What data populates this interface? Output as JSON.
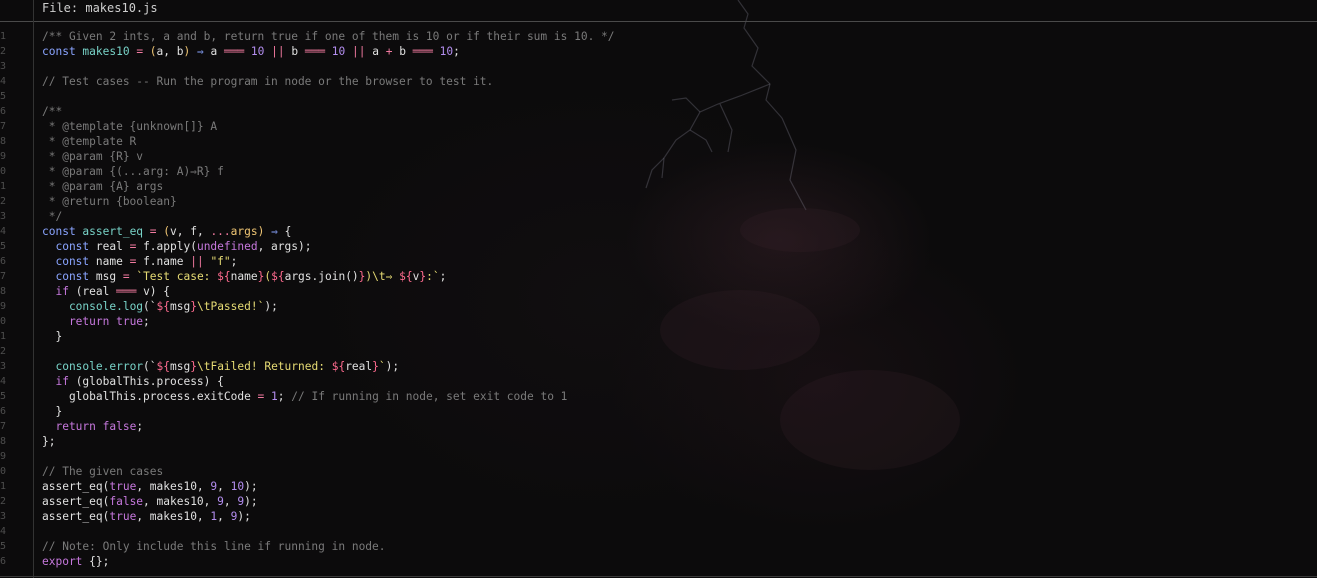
{
  "header": {
    "file_label": "File: makes10.js"
  },
  "lines": [
    {
      "n": "1",
      "tokens": [
        {
          "t": "/** Given 2 ints, a and b, return true if one of them is 10 or if their sum is 10. */",
          "c": "c"
        }
      ]
    },
    {
      "n": "2",
      "tokens": [
        {
          "t": "const ",
          "c": "kw"
        },
        {
          "t": "makes10",
          "c": "fn"
        },
        {
          "t": " = ",
          "c": "op"
        },
        {
          "t": "(",
          "c": "par"
        },
        {
          "t": "a, b",
          "c": "pl"
        },
        {
          "t": ")",
          "c": "par"
        },
        {
          "t": " ⇒ ",
          "c": "kw"
        },
        {
          "t": "a ",
          "c": "pl"
        },
        {
          "t": "═══ ",
          "c": "op"
        },
        {
          "t": "10",
          "c": "num"
        },
        {
          "t": " || ",
          "c": "op"
        },
        {
          "t": "b ",
          "c": "pl"
        },
        {
          "t": "═══ ",
          "c": "op"
        },
        {
          "t": "10",
          "c": "num"
        },
        {
          "t": " || ",
          "c": "op"
        },
        {
          "t": "a ",
          "c": "pl"
        },
        {
          "t": "+ ",
          "c": "op"
        },
        {
          "t": "b ",
          "c": "pl"
        },
        {
          "t": "═══ ",
          "c": "op"
        },
        {
          "t": "10",
          "c": "num"
        },
        {
          "t": ";",
          "c": "pl"
        }
      ]
    },
    {
      "n": "3",
      "tokens": []
    },
    {
      "n": "4",
      "tokens": [
        {
          "t": "// Test cases -- Run the program in node or the browser to test it.",
          "c": "c"
        }
      ]
    },
    {
      "n": "5",
      "tokens": []
    },
    {
      "n": "6",
      "tokens": [
        {
          "t": "/**",
          "c": "c"
        }
      ]
    },
    {
      "n": "7",
      "tokens": [
        {
          "t": " * @template {unknown[]} A",
          "c": "c"
        }
      ]
    },
    {
      "n": "8",
      "tokens": [
        {
          "t": " * @template R",
          "c": "c"
        }
      ]
    },
    {
      "n": "9",
      "tokens": [
        {
          "t": " * @param {R} v",
          "c": "c"
        }
      ]
    },
    {
      "n": "0",
      "tokens": [
        {
          "t": " * @param {(...arg: A)⇒R} f",
          "c": "c"
        }
      ]
    },
    {
      "n": "1",
      "tokens": [
        {
          "t": " * @param {A} args",
          "c": "c"
        }
      ]
    },
    {
      "n": "2",
      "tokens": [
        {
          "t": " * @return {boolean}",
          "c": "c"
        }
      ]
    },
    {
      "n": "3",
      "tokens": [
        {
          "t": " */",
          "c": "c"
        }
      ]
    },
    {
      "n": "4",
      "tokens": [
        {
          "t": "const ",
          "c": "kw"
        },
        {
          "t": "assert_eq",
          "c": "fn"
        },
        {
          "t": " = ",
          "c": "op"
        },
        {
          "t": "(",
          "c": "par"
        },
        {
          "t": "v, f, ",
          "c": "pl"
        },
        {
          "t": "...",
          "c": "op"
        },
        {
          "t": "args",
          "c": "par"
        },
        {
          "t": ")",
          "c": "par"
        },
        {
          "t": " ⇒ ",
          "c": "kw"
        },
        {
          "t": "{",
          "c": "pl"
        }
      ]
    },
    {
      "n": "5",
      "tokens": [
        {
          "t": "  const ",
          "c": "kw"
        },
        {
          "t": "real ",
          "c": "pl"
        },
        {
          "t": "= ",
          "c": "op"
        },
        {
          "t": "f.apply(",
          "c": "pl"
        },
        {
          "t": "undefined",
          "c": "kw2"
        },
        {
          "t": ", args);",
          "c": "pl"
        }
      ]
    },
    {
      "n": "6",
      "tokens": [
        {
          "t": "  const ",
          "c": "kw"
        },
        {
          "t": "name ",
          "c": "pl"
        },
        {
          "t": "= ",
          "c": "op"
        },
        {
          "t": "f.name ",
          "c": "pl"
        },
        {
          "t": "|| ",
          "c": "op"
        },
        {
          "t": "\"f\"",
          "c": "str"
        },
        {
          "t": ";",
          "c": "pl"
        }
      ]
    },
    {
      "n": "7",
      "tokens": [
        {
          "t": "  const ",
          "c": "kw"
        },
        {
          "t": "msg ",
          "c": "pl"
        },
        {
          "t": "= ",
          "c": "op"
        },
        {
          "t": "`Test case: ",
          "c": "str"
        },
        {
          "t": "${",
          "c": "tpl"
        },
        {
          "t": "name",
          "c": "pl"
        },
        {
          "t": "}",
          "c": "tpl"
        },
        {
          "t": "(",
          "c": "str"
        },
        {
          "t": "${",
          "c": "tpl"
        },
        {
          "t": "args.join()",
          "c": "pl"
        },
        {
          "t": "}",
          "c": "tpl"
        },
        {
          "t": ")\\t⇒ ",
          "c": "str"
        },
        {
          "t": "${",
          "c": "tpl"
        },
        {
          "t": "v",
          "c": "pl"
        },
        {
          "t": "}",
          "c": "tpl"
        },
        {
          "t": ":`",
          "c": "str"
        },
        {
          "t": ";",
          "c": "pl"
        }
      ]
    },
    {
      "n": "8",
      "tokens": [
        {
          "t": "  if ",
          "c": "kw2"
        },
        {
          "t": "(real ",
          "c": "pl"
        },
        {
          "t": "═══ ",
          "c": "op"
        },
        {
          "t": "v) {",
          "c": "pl"
        }
      ]
    },
    {
      "n": "9",
      "tokens": [
        {
          "t": "    console.",
          "c": "fn"
        },
        {
          "t": "log",
          "c": "fn"
        },
        {
          "t": "(`",
          "c": "pl"
        },
        {
          "t": "${",
          "c": "tpl"
        },
        {
          "t": "msg",
          "c": "pl"
        },
        {
          "t": "}",
          "c": "tpl"
        },
        {
          "t": "\\tPassed!`",
          "c": "str"
        },
        {
          "t": ");",
          "c": "pl"
        }
      ]
    },
    {
      "n": "0",
      "tokens": [
        {
          "t": "    return ",
          "c": "kw2"
        },
        {
          "t": "true",
          "c": "kw2"
        },
        {
          "t": ";",
          "c": "pl"
        }
      ]
    },
    {
      "n": "1",
      "tokens": [
        {
          "t": "  }",
          "c": "pl"
        }
      ]
    },
    {
      "n": "2",
      "tokens": []
    },
    {
      "n": "3",
      "tokens": [
        {
          "t": "  console.",
          "c": "fn"
        },
        {
          "t": "error",
          "c": "fn"
        },
        {
          "t": "(`",
          "c": "pl"
        },
        {
          "t": "${",
          "c": "tpl"
        },
        {
          "t": "msg",
          "c": "pl"
        },
        {
          "t": "}",
          "c": "tpl"
        },
        {
          "t": "\\tFailed! Returned: ",
          "c": "str"
        },
        {
          "t": "${",
          "c": "tpl"
        },
        {
          "t": "real",
          "c": "pl"
        },
        {
          "t": "}",
          "c": "tpl"
        },
        {
          "t": "`",
          "c": "str"
        },
        {
          "t": ");",
          "c": "pl"
        }
      ]
    },
    {
      "n": "4",
      "tokens": [
        {
          "t": "  if ",
          "c": "kw2"
        },
        {
          "t": "(globalThis.process) {",
          "c": "pl"
        }
      ]
    },
    {
      "n": "5",
      "tokens": [
        {
          "t": "    globalThis.process.exitCode ",
          "c": "pl"
        },
        {
          "t": "= ",
          "c": "op"
        },
        {
          "t": "1",
          "c": "num"
        },
        {
          "t": "; ",
          "c": "pl"
        },
        {
          "t": "// If running in node, set exit code to 1",
          "c": "c"
        }
      ]
    },
    {
      "n": "6",
      "tokens": [
        {
          "t": "  }",
          "c": "pl"
        }
      ]
    },
    {
      "n": "7",
      "tokens": [
        {
          "t": "  return ",
          "c": "kw2"
        },
        {
          "t": "false",
          "c": "kw2"
        },
        {
          "t": ";",
          "c": "pl"
        }
      ]
    },
    {
      "n": "8",
      "tokens": [
        {
          "t": "};",
          "c": "pl"
        }
      ]
    },
    {
      "n": "9",
      "tokens": []
    },
    {
      "n": "0",
      "tokens": [
        {
          "t": "// The given cases",
          "c": "c"
        }
      ]
    },
    {
      "n": "1",
      "tokens": [
        {
          "t": "assert_eq(",
          "c": "pl"
        },
        {
          "t": "true",
          "c": "kw2"
        },
        {
          "t": ", makes10, ",
          "c": "pl"
        },
        {
          "t": "9",
          "c": "num"
        },
        {
          "t": ", ",
          "c": "pl"
        },
        {
          "t": "10",
          "c": "num"
        },
        {
          "t": ");",
          "c": "pl"
        }
      ]
    },
    {
      "n": "2",
      "tokens": [
        {
          "t": "assert_eq(",
          "c": "pl"
        },
        {
          "t": "false",
          "c": "kw2"
        },
        {
          "t": ", makes10, ",
          "c": "pl"
        },
        {
          "t": "9",
          "c": "num"
        },
        {
          "t": ", ",
          "c": "pl"
        },
        {
          "t": "9",
          "c": "num"
        },
        {
          "t": ");",
          "c": "pl"
        }
      ]
    },
    {
      "n": "3",
      "tokens": [
        {
          "t": "assert_eq(",
          "c": "pl"
        },
        {
          "t": "true",
          "c": "kw2"
        },
        {
          "t": ", makes10, ",
          "c": "pl"
        },
        {
          "t": "1",
          "c": "num"
        },
        {
          "t": ", ",
          "c": "pl"
        },
        {
          "t": "9",
          "c": "num"
        },
        {
          "t": ");",
          "c": "pl"
        }
      ]
    },
    {
      "n": "4",
      "tokens": []
    },
    {
      "n": "5",
      "tokens": [
        {
          "t": "// Note: Only include this line if running in node.",
          "c": "c"
        }
      ]
    },
    {
      "n": "6",
      "tokens": [
        {
          "t": "export ",
          "c": "kw2"
        },
        {
          "t": "{};",
          "c": "pl"
        }
      ]
    }
  ]
}
